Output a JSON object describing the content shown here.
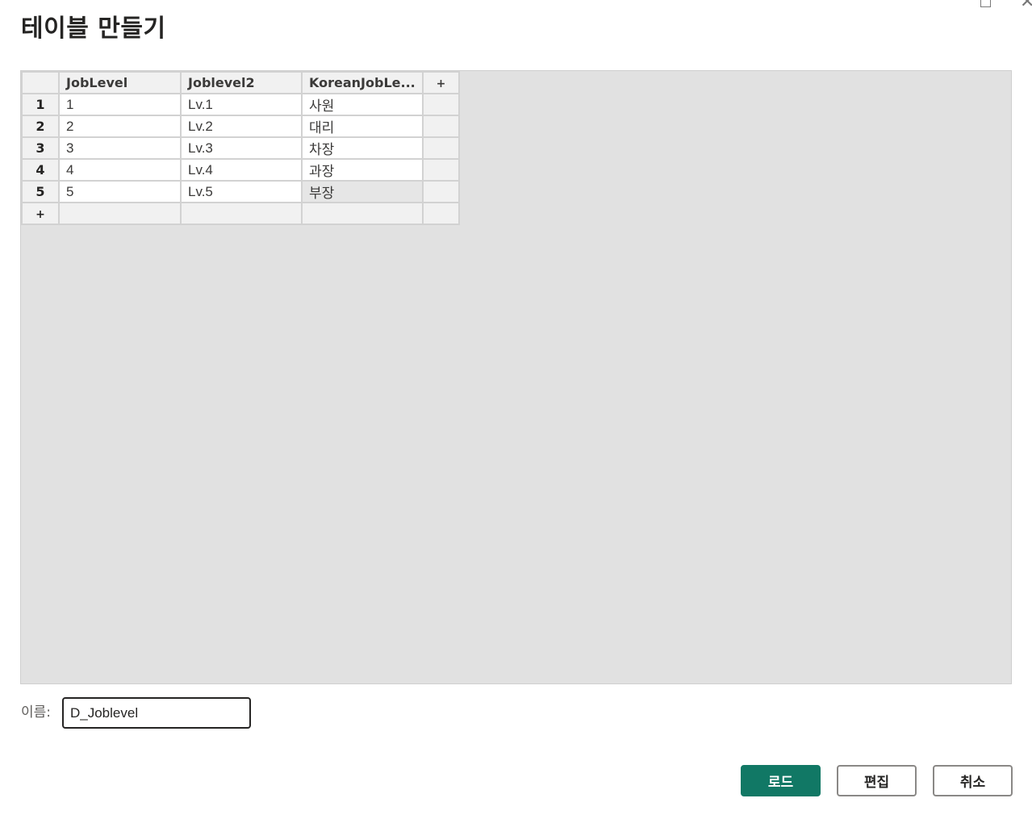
{
  "dialog": {
    "title": "테이블 만들기"
  },
  "table": {
    "add_symbol": "+",
    "columns": [
      "JobLevel",
      "Joblevel2",
      "KoreanJobLe..."
    ],
    "rows": [
      {
        "num": "1",
        "cells": [
          "1",
          "Lv.1",
          "사원"
        ]
      },
      {
        "num": "2",
        "cells": [
          "2",
          "Lv.2",
          "대리"
        ]
      },
      {
        "num": "3",
        "cells": [
          "3",
          "Lv.3",
          "차장"
        ]
      },
      {
        "num": "4",
        "cells": [
          "4",
          "Lv.4",
          "과장"
        ]
      },
      {
        "num": "5",
        "cells": [
          "5",
          "Lv.5",
          "부장"
        ]
      }
    ]
  },
  "name_field": {
    "label": "이름:",
    "value": "D_Joblevel"
  },
  "buttons": {
    "load": "로드",
    "edit": "편집",
    "cancel": "취소"
  },
  "colors": {
    "primary": "#117865",
    "grid_bg": "#e1e1e1"
  },
  "icons": {
    "maximize": "maximize-icon",
    "close": "close-icon"
  }
}
